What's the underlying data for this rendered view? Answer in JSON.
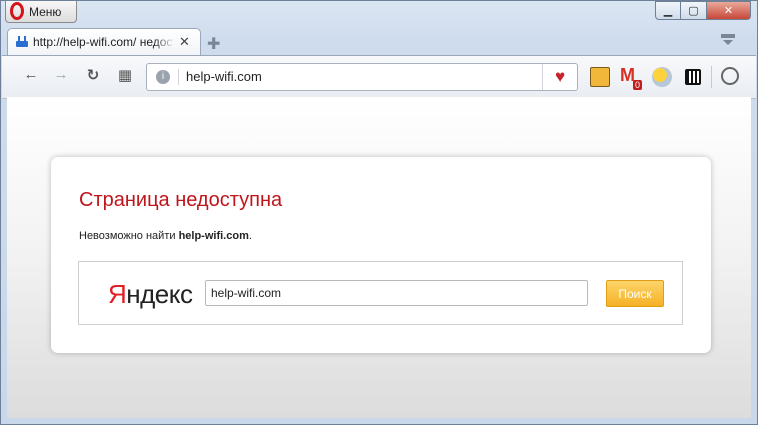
{
  "window": {
    "menu_label": "Меню"
  },
  "tab": {
    "title": "http://help-wifi.com/ недоступна",
    "close_glyph": "✕",
    "new_tab_glyph": "✚"
  },
  "toolbar": {
    "back_glyph": "←",
    "forward_glyph": "→",
    "reload_glyph": "↻",
    "speed_dial_glyph": "▦",
    "address_value": "help-wifi.com",
    "heart_glyph": "♥",
    "mail_badge": "0"
  },
  "error_page": {
    "title": "Страница недоступна",
    "message_prefix": "Невозможно найти ",
    "message_host": "help-wifi.com",
    "message_suffix": "."
  },
  "search": {
    "logo_first": "Я",
    "logo_rest": "ндекс",
    "query": "help-wifi.com",
    "button_label": "Поиск"
  }
}
